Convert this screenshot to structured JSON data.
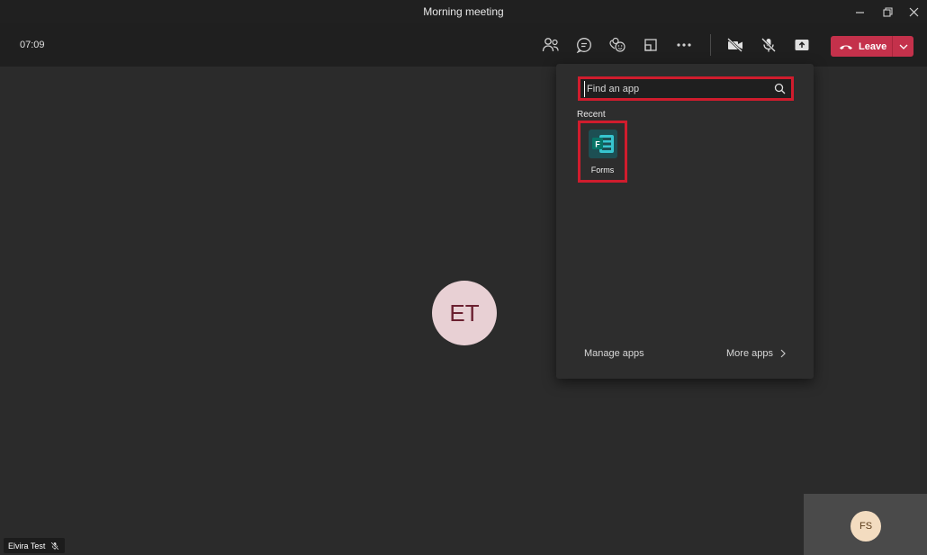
{
  "window": {
    "title": "Morning meeting",
    "controls": [
      "minimize",
      "restore",
      "close"
    ]
  },
  "toolbar": {
    "timer": "07:09",
    "icons": [
      "people-icon",
      "chat-icon",
      "reactions-icon",
      "rooms-icon",
      "more-icon",
      "camera-off-icon",
      "mic-off-icon",
      "share-icon"
    ],
    "leave_label": "Leave",
    "leave_color": "#c4314b"
  },
  "stage": {
    "main_avatar_initials": "ET",
    "main_avatar_bg": "#e8d0d4",
    "self_avatar_initials": "FS",
    "participant_name": "Elvira Test"
  },
  "apps_flyout": {
    "search_placeholder": "Find an app",
    "recent_label": "Recent",
    "recent_apps": [
      {
        "label": "Forms",
        "icon": "forms-icon"
      }
    ],
    "manage_apps_label": "Manage apps",
    "more_apps_label": "More apps",
    "highlight_color": "#d01c2d"
  }
}
